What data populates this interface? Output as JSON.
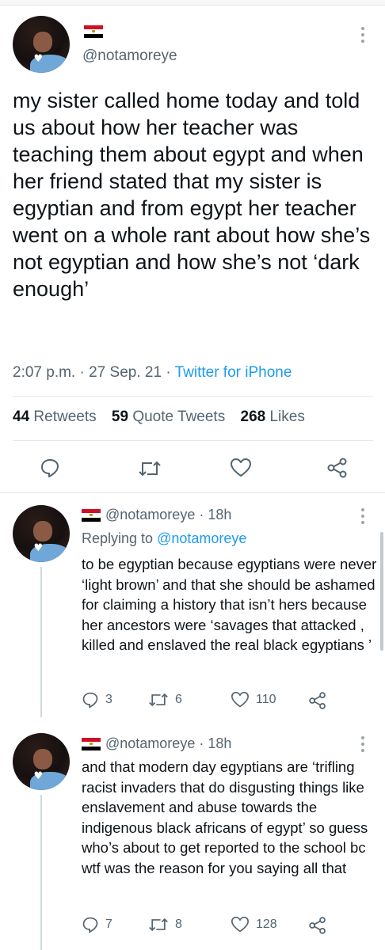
{
  "main_tweet": {
    "handle": "@notamoreye",
    "text": "my sister called home today and told us about how her teacher was teaching them about egypt and when her friend stated that my sister is egyptian and from egypt her teacher went on a whole rant about how she’s not egyptian and how she’s not ‘dark enough’",
    "time": "2:07 p.m.",
    "date": "27 Sep. 21",
    "source": "Twitter for iPhone",
    "dot": "·",
    "retweets_count": "44",
    "retweets_label": "Retweets",
    "quotes_count": "59",
    "quotes_label": "Quote Tweets",
    "likes_count": "268",
    "likes_label": "Likes"
  },
  "replies": [
    {
      "header": "@notamoreye · 18h",
      "replying_prefix": "Replying to",
      "replying_mention": "@notamoreye",
      "text": "to be egyptian because egyptians were never ‘light brown’ and that she should be ashamed for claiming a history that isn’t hers because her ancestors were ‘savages that attacked , killed and enslaved the real black egyptians ’",
      "replies": "3",
      "retweets": "6",
      "likes": "110"
    },
    {
      "header": "@notamoreye · 18h",
      "text": "and that modern day egyptians are ‘trifling racist invaders that do disgusting things like enslavement and abuse towards the indigenous black africans of egypt’ so guess who’s about to get reported to the school bc wtf was the reason for you saying all that",
      "replies": "7",
      "retweets": "8",
      "likes": "128"
    }
  ],
  "icons": {
    "flag": "egypt-flag-icon",
    "more": "more-options-icon",
    "reply": "reply-icon",
    "retweet": "retweet-icon",
    "like": "like-icon",
    "share": "share-icon"
  },
  "colors": {
    "text": "#0f1419",
    "muted": "#536471",
    "link": "#1d9bf0"
  }
}
